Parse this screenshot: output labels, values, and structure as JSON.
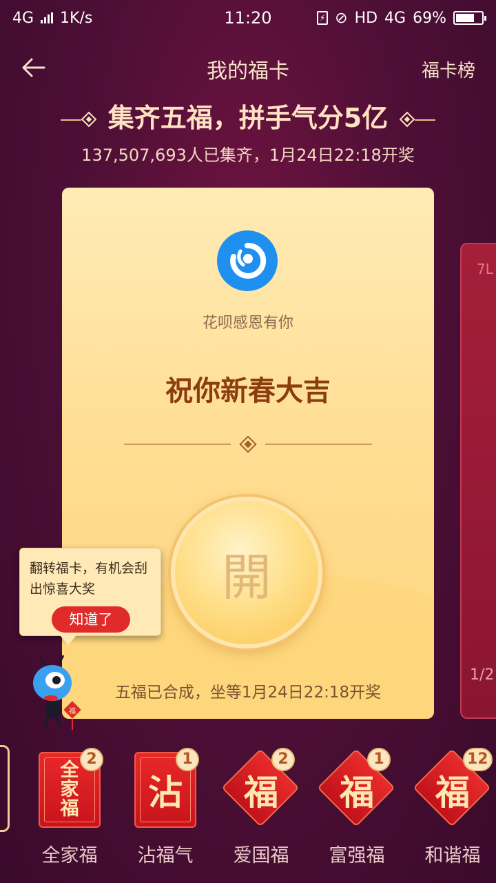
{
  "status_bar": {
    "network": "4G",
    "speed": "1K/s",
    "time": "11:20",
    "hd": "HD",
    "network2": "4G",
    "battery": "69%"
  },
  "header": {
    "title": "我的福卡",
    "ranking": "福卡榜"
  },
  "banner": {
    "title": "集齐五福，拼手气分5亿",
    "subtitle": "137,507,693人已集齐，1月24日22:18开奖"
  },
  "card": {
    "brand": "花呗感恩有你",
    "greeting": "祝你新春大吉",
    "open_label": "開",
    "status": "五福已合成，坐等1月24日22:18开奖"
  },
  "next_card": {
    "top_text": "7L",
    "pager": "1/2"
  },
  "tooltip": {
    "text": "翻转福卡，有机会刮出惊喜大奖",
    "button": "知道了"
  },
  "cards": [
    {
      "name": "全家福",
      "glyph": "全家福",
      "count": "2"
    },
    {
      "name": "沾福气",
      "glyph": "沾",
      "count": "1"
    },
    {
      "name": "爱国福",
      "glyph": "福",
      "count": "2"
    },
    {
      "name": "富强福",
      "glyph": "福",
      "count": "1"
    },
    {
      "name": "和谐福",
      "glyph": "福",
      "count": "12"
    }
  ],
  "colors": {
    "background": "#4f0f36",
    "card_gold": "#ffdc8f",
    "accent_red": "#e12a2a",
    "logo_blue": "#1f8ff0"
  }
}
